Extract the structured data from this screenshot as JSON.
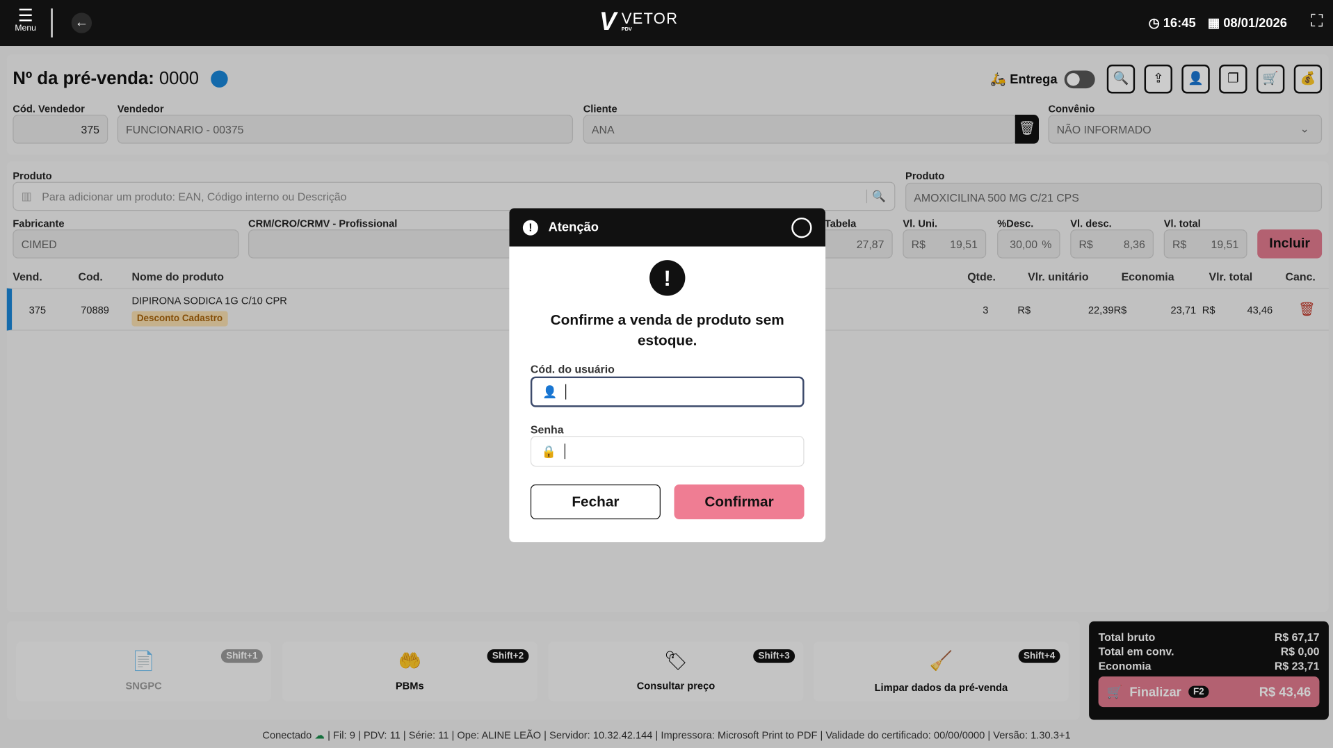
{
  "topbar": {
    "menu_label": "Menu",
    "logo": "VETOR",
    "logo_sub": "PDV",
    "time": "16:45",
    "date": "08/01/2026"
  },
  "header": {
    "title_label": "Nº da pré-venda:",
    "number": "0000",
    "delivery_label": "Entrega"
  },
  "fields": {
    "cod_vendedor_label": "Cód. Vendedor",
    "cod_vendedor": "375",
    "vendedor_label": "Vendedor",
    "vendedor": "FUNCIONARIO - 00375",
    "cliente_label": "Cliente",
    "cliente": "ANA",
    "convenio_label": "Convênio",
    "convenio": "NÃO INFORMADO",
    "produto_label": "Produto",
    "produto_placeholder": "Para adicionar um produto: EAN, Código interno ou Descrição",
    "produto2_label": "Produto",
    "produto2": "AMOXICILINA 500 MG C/21 CPS",
    "fabricante_label": "Fabricante",
    "fabricante": "CIMED",
    "crm_label": "CRM/CRO/CRMV - Profissional",
    "tabela_label": "Tabela",
    "tabela": "27,87",
    "vl_uni_label": "Vl. Uni.",
    "vl_uni": "19,51",
    "desc_pct_label": "%Desc.",
    "desc_pct": "30,00",
    "vl_desc_label": "Vl. desc.",
    "vl_desc": "8,36",
    "vl_total_label": "Vl. total",
    "vl_total": "19,51",
    "currency": "R$",
    "percent": "%",
    "incluir": "Incluir"
  },
  "table": {
    "headers": [
      "Vend.",
      "Cod.",
      "Nome do produto",
      "Qtde.",
      "Vlr. unitário",
      "Economia",
      "Vlr. total",
      "Canc."
    ],
    "rows": [
      {
        "vend": "375",
        "cod": "70889",
        "nome": "DIPIRONA SODICA 1G C/10 CPR",
        "badge": "Desconto Cadastro",
        "qtde": "3",
        "unit": "22,39",
        "economia": "23,71",
        "total": "43,46"
      }
    ]
  },
  "modal": {
    "title": "Atenção",
    "message": "Confirme a venda de produto sem estoque.",
    "user_label": "Cód. do usuário",
    "password_label": "Senha",
    "close": "Fechar",
    "confirm": "Confirmar"
  },
  "actions": [
    {
      "label": "SNGPC",
      "key": "Shift+1"
    },
    {
      "label": "PBMs",
      "key": "Shift+2"
    },
    {
      "label": "Consultar preço",
      "key": "Shift+3"
    },
    {
      "label": "Limpar dados da pré-venda",
      "key": "Shift+4"
    }
  ],
  "totals": {
    "bruto_label": "Total bruto",
    "bruto": "R$ 67,17",
    "conv_label": "Total em conv.",
    "conv": "R$ 0,00",
    "eco_label": "Economia",
    "eco": "R$ 23,71",
    "finalizar": "Finalizar",
    "key": "F2",
    "final": "R$ 43,46"
  },
  "status": {
    "connected": "Conectado",
    "info": "| Fil: 9 | PDV: 11 | Série: 11 | Ope: ALINE LEÃO | Servidor: 10.32.42.144 | Impressora: Microsoft Print to PDF | Validade do certificado: 00/00/0000 | Versão: 1.30.3+1"
  },
  "colors": {
    "accent": "#e07a8e",
    "blue": "#1a85d6",
    "dark": "#111111"
  }
}
